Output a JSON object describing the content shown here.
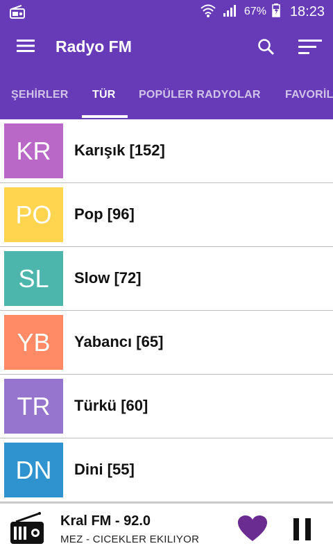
{
  "status_bar": {
    "battery": "67%",
    "time": "18:23"
  },
  "app_bar": {
    "title": "Radyo FM"
  },
  "tabs": [
    {
      "label": "ŞEHİRLER",
      "active": false
    },
    {
      "label": "TÜR",
      "active": true
    },
    {
      "label": "POPÜLER RADYOLAR",
      "active": false
    },
    {
      "label": "FAVORİLER",
      "active": false
    }
  ],
  "genres": [
    {
      "abbr": "KR",
      "label": "Karışık [152]",
      "color": "#BA68C8"
    },
    {
      "abbr": "PO",
      "label": "Pop [96]",
      "color": "#FFD54F"
    },
    {
      "abbr": "SL",
      "label": "Slow [72]",
      "color": "#4DB6AC"
    },
    {
      "abbr": "YB",
      "label": "Yabancı [65]",
      "color": "#FF8A65"
    },
    {
      "abbr": "TR",
      "label": "Türkü [60]",
      "color": "#9575CD"
    },
    {
      "abbr": "DN",
      "label": "Dini [55]",
      "color": "#2E93CE"
    }
  ],
  "player": {
    "station": "Kral FM - 92.0",
    "song": "MEZ - CICEKLER EKILIYOR",
    "accent": "#6A2C91"
  },
  "colors": {
    "primary": "#673AB7"
  }
}
